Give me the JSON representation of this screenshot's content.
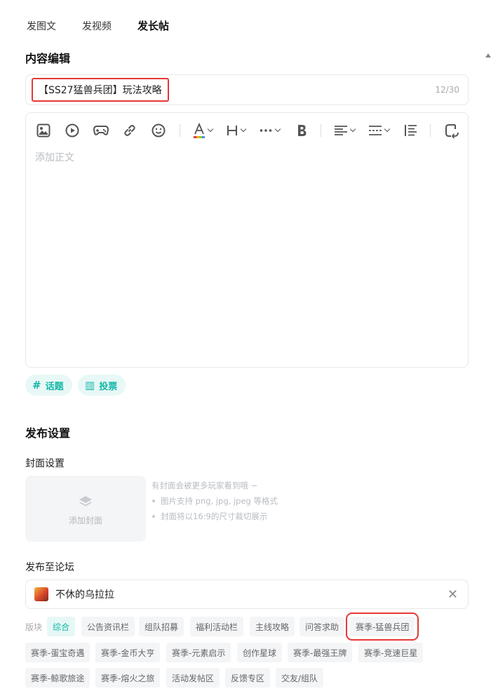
{
  "tabs": [
    {
      "label": "发图文"
    },
    {
      "label": "发视频"
    },
    {
      "label": "发长帖"
    }
  ],
  "content_section": {
    "title": "内容编辑",
    "post_title": "【SS27猛兽兵团】玩法攻略",
    "title_count": "12/30",
    "editor_placeholder": "添加正文",
    "toolbar_icons": [
      "image-icon",
      "video-icon",
      "game-icon",
      "link-icon",
      "emoji-icon",
      "font-color-icon",
      "heading-icon",
      "more-icon",
      "bold-icon",
      "align-icon",
      "divider-icon",
      "indent-icon",
      "rotate-icon"
    ],
    "accent_color": "#1fd3c6"
  },
  "chips": [
    {
      "icon": "#",
      "label": "话题"
    },
    {
      "icon": "▥",
      "label": "投票"
    }
  ],
  "publish_section": {
    "title": "发布设置",
    "cover_label": "封面设置",
    "cover_button": "添加封面",
    "cover_tips": [
      "有封面会被更多玩家看到哦 ~",
      "图片支持 png, jpg, jpeg 等格式",
      "封面将以16:9的尺寸裁切展示"
    ],
    "forum_label": "发布至论坛",
    "forum_name": "不休的乌拉拉",
    "board_label": "版块",
    "boards": [
      "综合",
      "公告资讯栏",
      "组队招募",
      "福利活动栏",
      "主线攻略",
      "问答求助",
      "赛季-猛兽兵团",
      "赛季-蛋宝奇遇",
      "赛季-金币大亨",
      "赛季-元素启示",
      "创作星球",
      "赛季-最强王牌",
      "赛季-竞速巨星",
      "赛季-鲸歌旅途",
      "赛季-熔火之旅",
      "活动发帖区",
      "反馈专区",
      "交友/组队"
    ],
    "active_board": "综合",
    "highlighted_board": "赛季-猛兽兵团"
  }
}
